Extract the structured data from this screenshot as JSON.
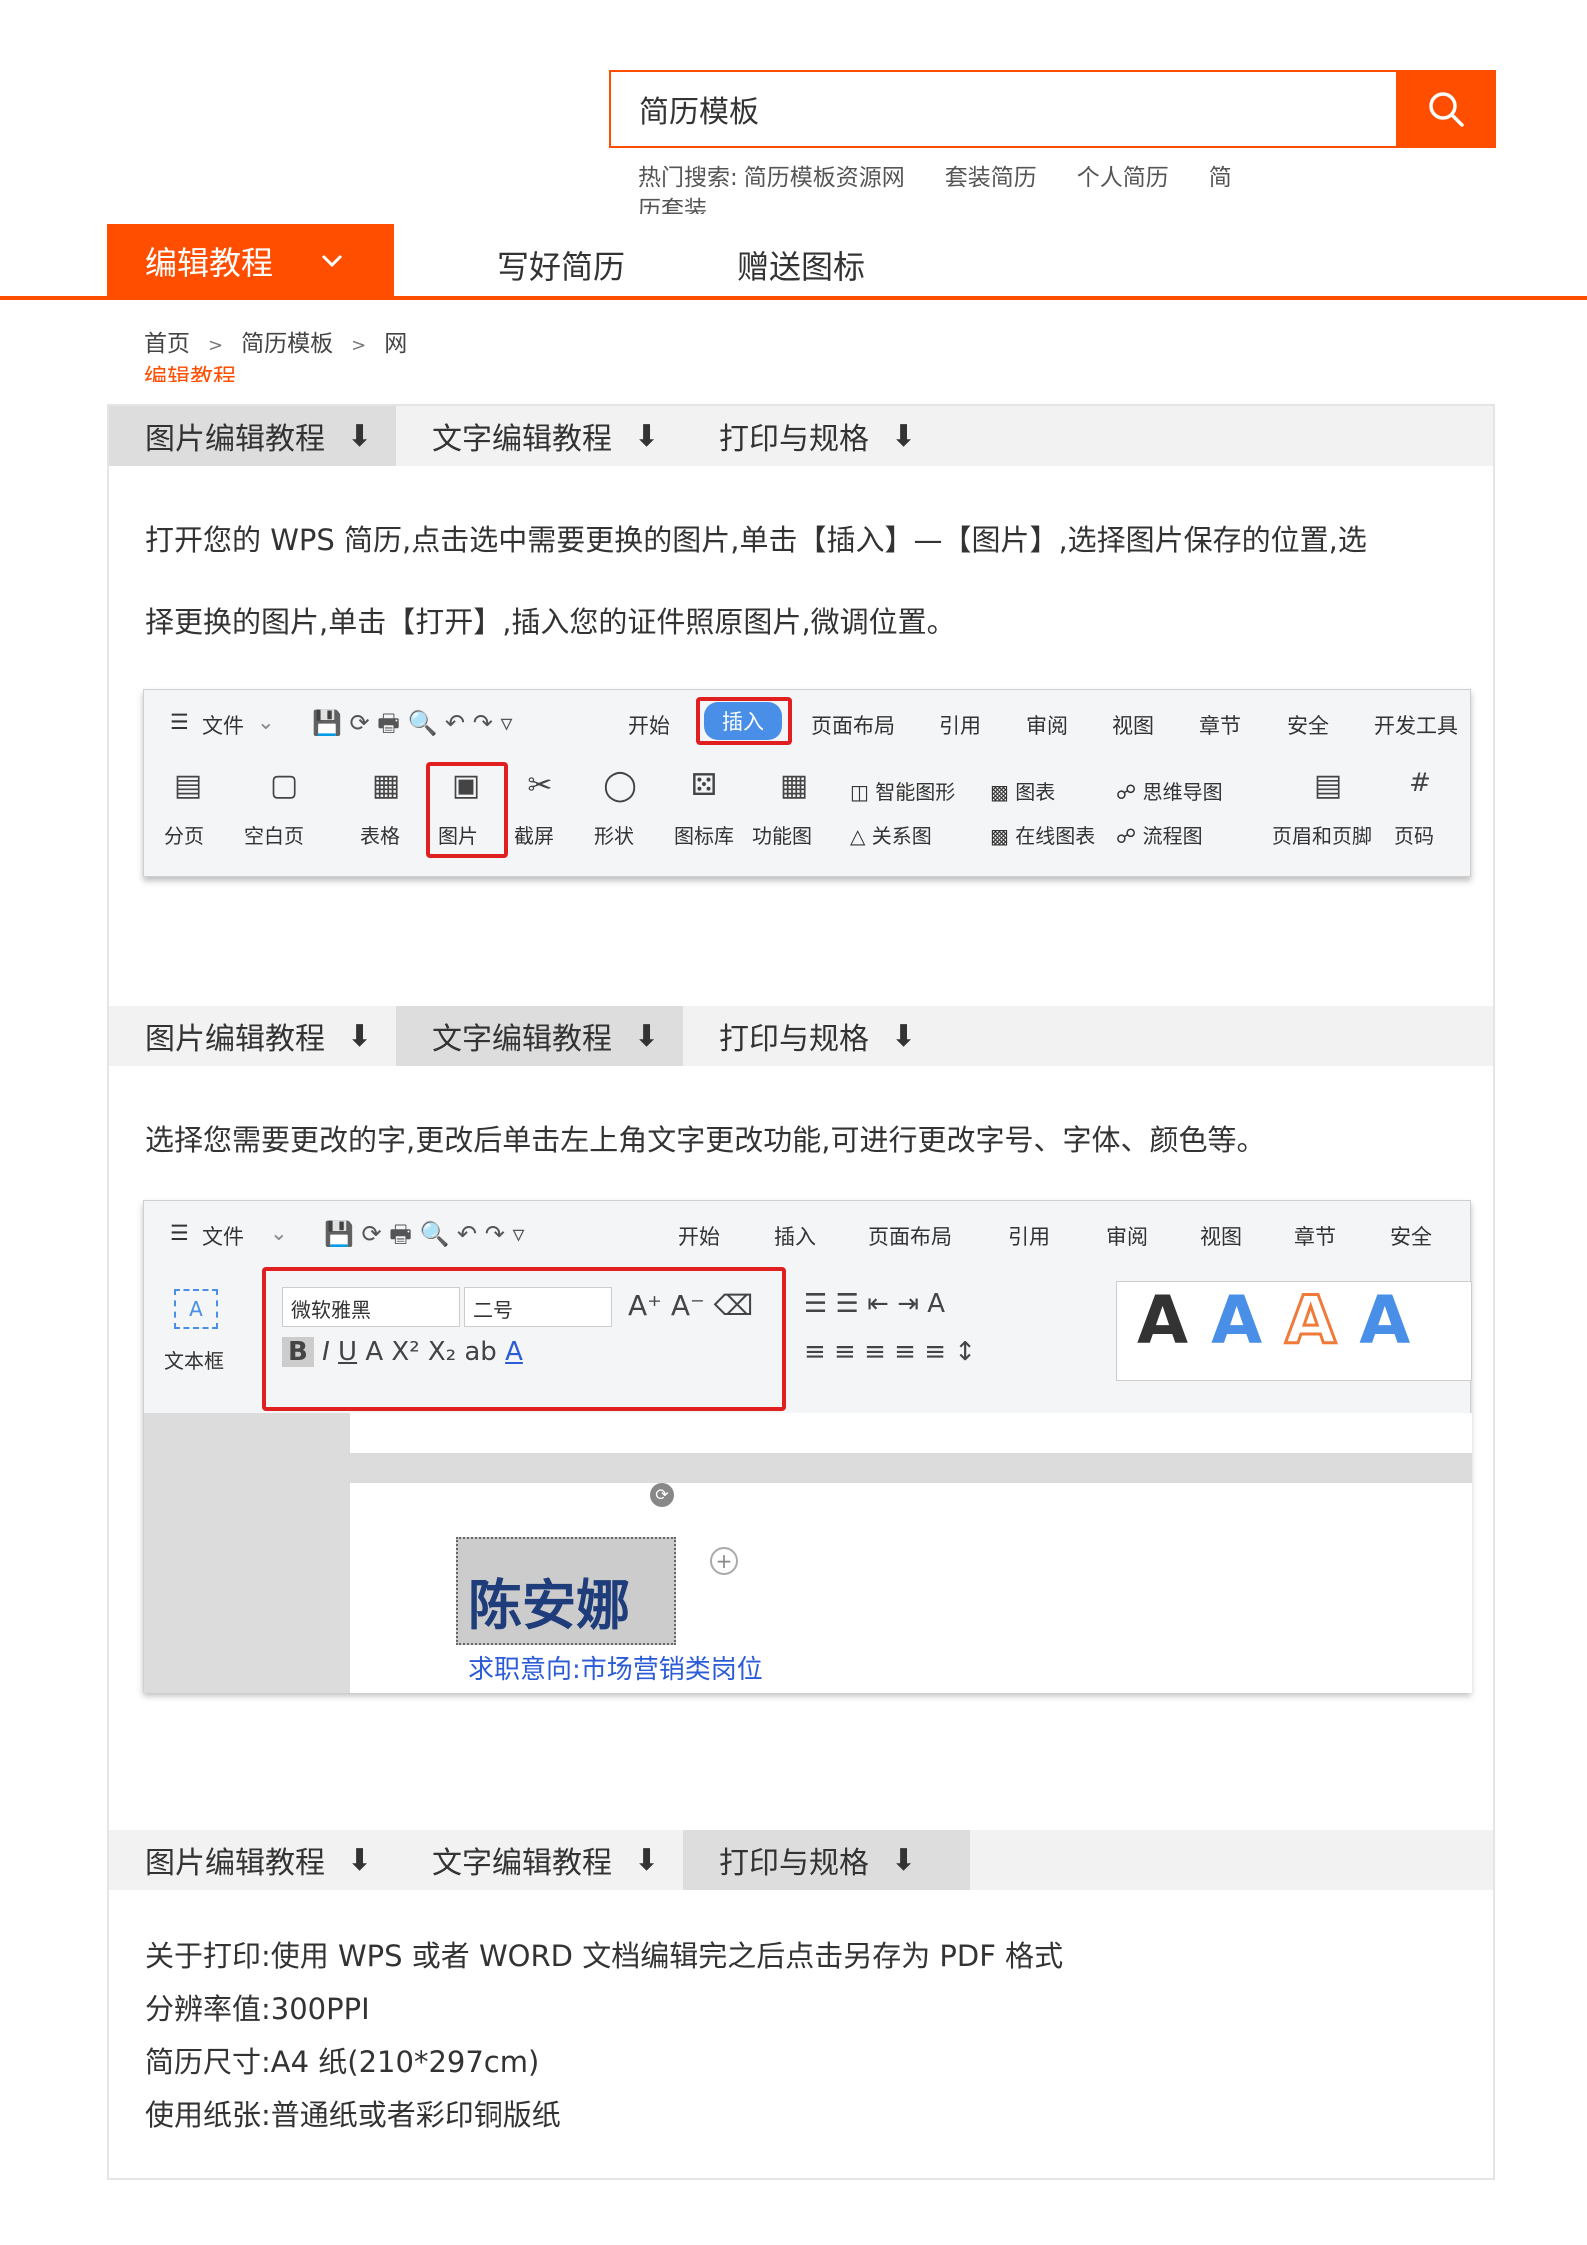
{
  "search": {
    "value": "简历模板"
  },
  "hot": {
    "label": "热门搜索:",
    "items": [
      "简历模板资源网",
      "套装简历",
      "个人简历",
      "简"
    ],
    "overflow": "历套装"
  },
  "nav": {
    "active": "编辑教程",
    "items": [
      "写好简历",
      "赠送图标"
    ]
  },
  "breadcrumb": {
    "items": [
      "首页",
      "简历模板",
      "网"
    ],
    "overflow": "编辑教程"
  },
  "tabs": [
    "图片编辑教程",
    "文字编辑教程",
    "打印与规格"
  ],
  "section1": {
    "line1": "打开您的 WPS 简历,点击选中需要更换的图片,单击【插入】—【图片】,选择图片保存的位置,选",
    "line2": "择更换的图片,单击【打开】,插入您的证件照原图片,微调位置。"
  },
  "wps1": {
    "menu": [
      "文件",
      "开始",
      "插入",
      "页面布局",
      "引用",
      "审阅",
      "视图",
      "章节",
      "安全",
      "开发工具"
    ],
    "tools": [
      "分页",
      "空白页",
      "表格",
      "图片",
      "截屏",
      "形状",
      "图标库",
      "功能图",
      "智能图形",
      "关系图",
      "图表",
      "在线图表",
      "思维导图",
      "流程图",
      "页眉和页脚",
      "页码"
    ]
  },
  "section2": {
    "text": "选择您需要更改的字,更改后单击左上角文字更改功能,可进行更改字号、字体、颜色等。"
  },
  "wps2": {
    "menu": [
      "文件",
      "开始",
      "插入",
      "页面布局",
      "引用",
      "审阅",
      "视图",
      "章节",
      "安全"
    ],
    "font": "微软雅黑",
    "size": "二号",
    "textbox": "文本框",
    "name": "陈安娜",
    "subtitle": "求职意向:市场营销类岗位"
  },
  "section3": {
    "lines": [
      "关于打印:使用 WPS 或者 WORD 文档编辑完之后点击另存为 PDF 格式",
      "分辨率值:300PPI",
      "简历尺寸:A4 纸(210*297cm)",
      "使用纸张:普通纸或者彩印铜版纸"
    ]
  },
  "colors": {
    "accent": "#ff4e00",
    "highlight": "#e02020",
    "wpsBlue": "#4a8fe7"
  }
}
